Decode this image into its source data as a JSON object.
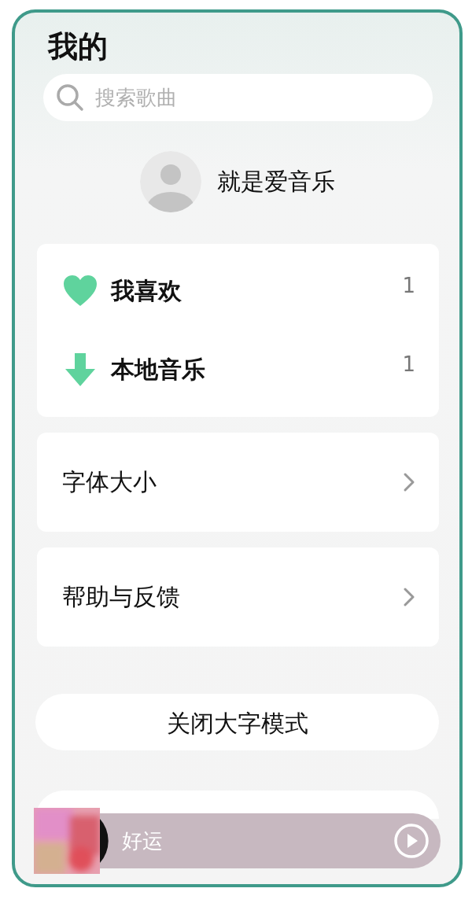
{
  "header": {
    "title": "我的"
  },
  "search": {
    "placeholder": "搜索歌曲"
  },
  "profile": {
    "name": "就是爱音乐"
  },
  "library": [
    {
      "kind": "heart",
      "label": "我喜欢",
      "count": "1"
    },
    {
      "kind": "download",
      "label": "本地音乐",
      "count": "1"
    }
  ],
  "settings": [
    {
      "label": "字体大小"
    },
    {
      "label": "帮助与反馈"
    }
  ],
  "buttons": [
    {
      "kind": "normal",
      "label": "关闭大字模式"
    },
    {
      "kind": "hidden"
    }
  ],
  "player": {
    "title": "好运"
  }
}
